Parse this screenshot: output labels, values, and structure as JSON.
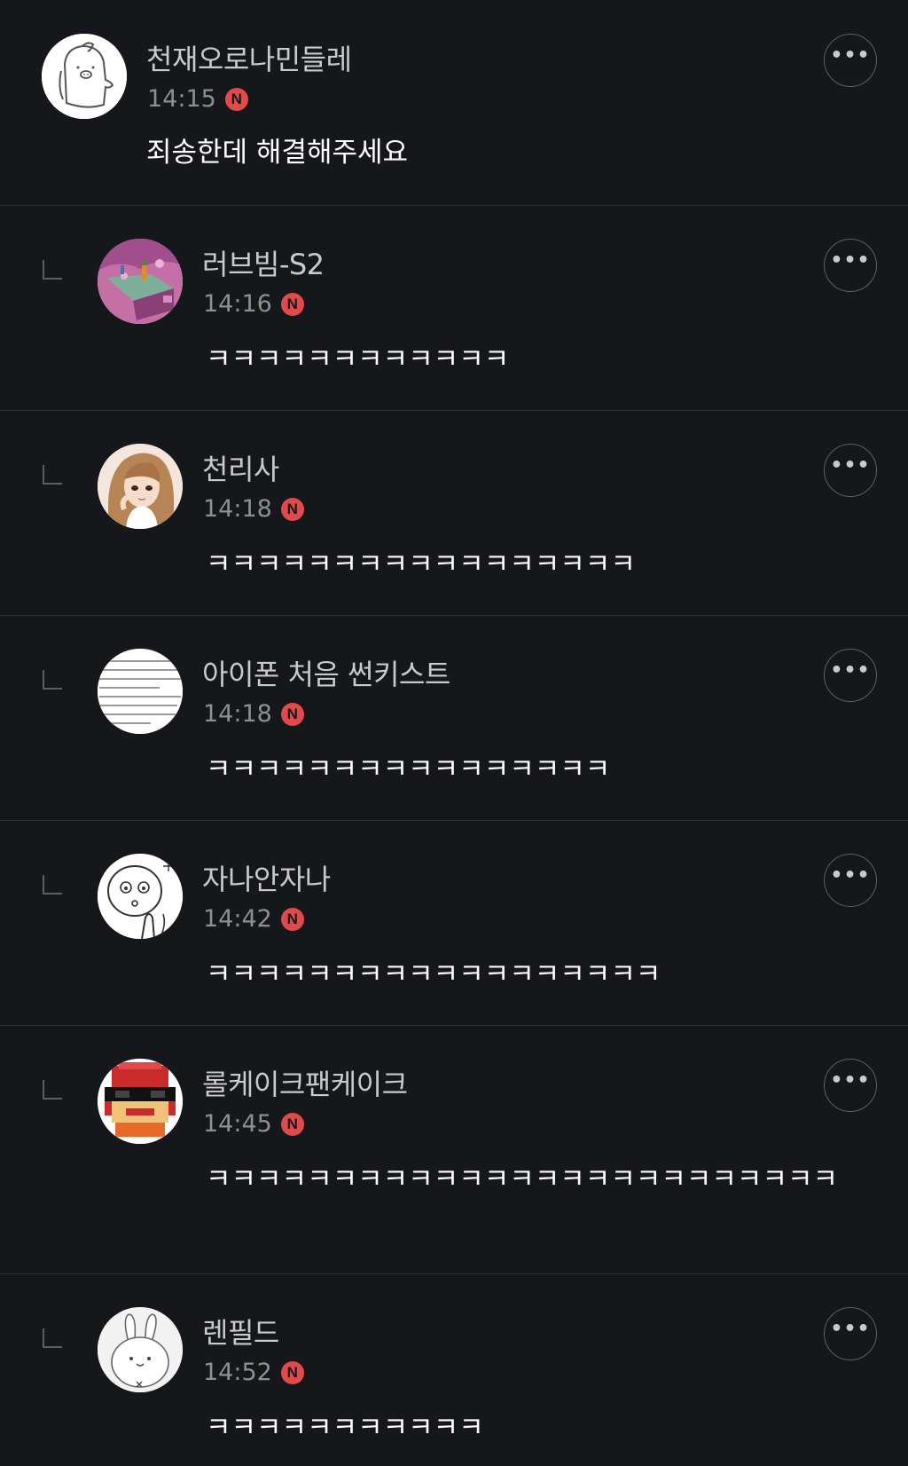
{
  "comments": [
    {
      "nickname": "천재오로나민들레",
      "time": "14:15",
      "badge": "N",
      "text": "죄송한데 해결해주세요"
    },
    {
      "nickname": "러브빔-S2",
      "time": "14:16",
      "badge": "N",
      "text": "ㅋㅋㅋㅋㅋㅋㅋㅋㅋㅋㅋㅋ"
    },
    {
      "nickname": "천리사",
      "time": "14:18",
      "badge": "N",
      "text": "ㅋㅋㅋㅋㅋㅋㅋㅋㅋㅋㅋㅋㅋㅋㅋㅋㅋ"
    },
    {
      "nickname": "아이폰 처음 썬키스트",
      "time": "14:18",
      "badge": "N",
      "text": "ㅋㅋㅋㅋㅋㅋㅋㅋㅋㅋㅋㅋㅋㅋㅋㅋ"
    },
    {
      "nickname": "자나안자나",
      "time": "14:42",
      "badge": "N",
      "text": "ㅋㅋㅋㅋㅋㅋㅋㅋㅋㅋㅋㅋㅋㅋㅋㅋㅋㅋ"
    },
    {
      "nickname": "롤케이크팬케이크",
      "time": "14:45",
      "badge": "N",
      "text": "ㅋㅋㅋㅋㅋㅋㅋㅋㅋㅋㅋㅋㅋㅋㅋㅋㅋㅋㅋㅋㅋㅋㅋㅋㅋ"
    },
    {
      "nickname": "렌필드",
      "time": "14:52",
      "badge": "N",
      "text": "ㅋㅋㅋㅋㅋㅋㅋㅋㅋㅋㅋ"
    }
  ],
  "more_button_label": "•••",
  "colors": {
    "background": "#16171a",
    "badge": "#e04a4a",
    "nickname": "#c9cacd",
    "time": "#8e8f94"
  }
}
